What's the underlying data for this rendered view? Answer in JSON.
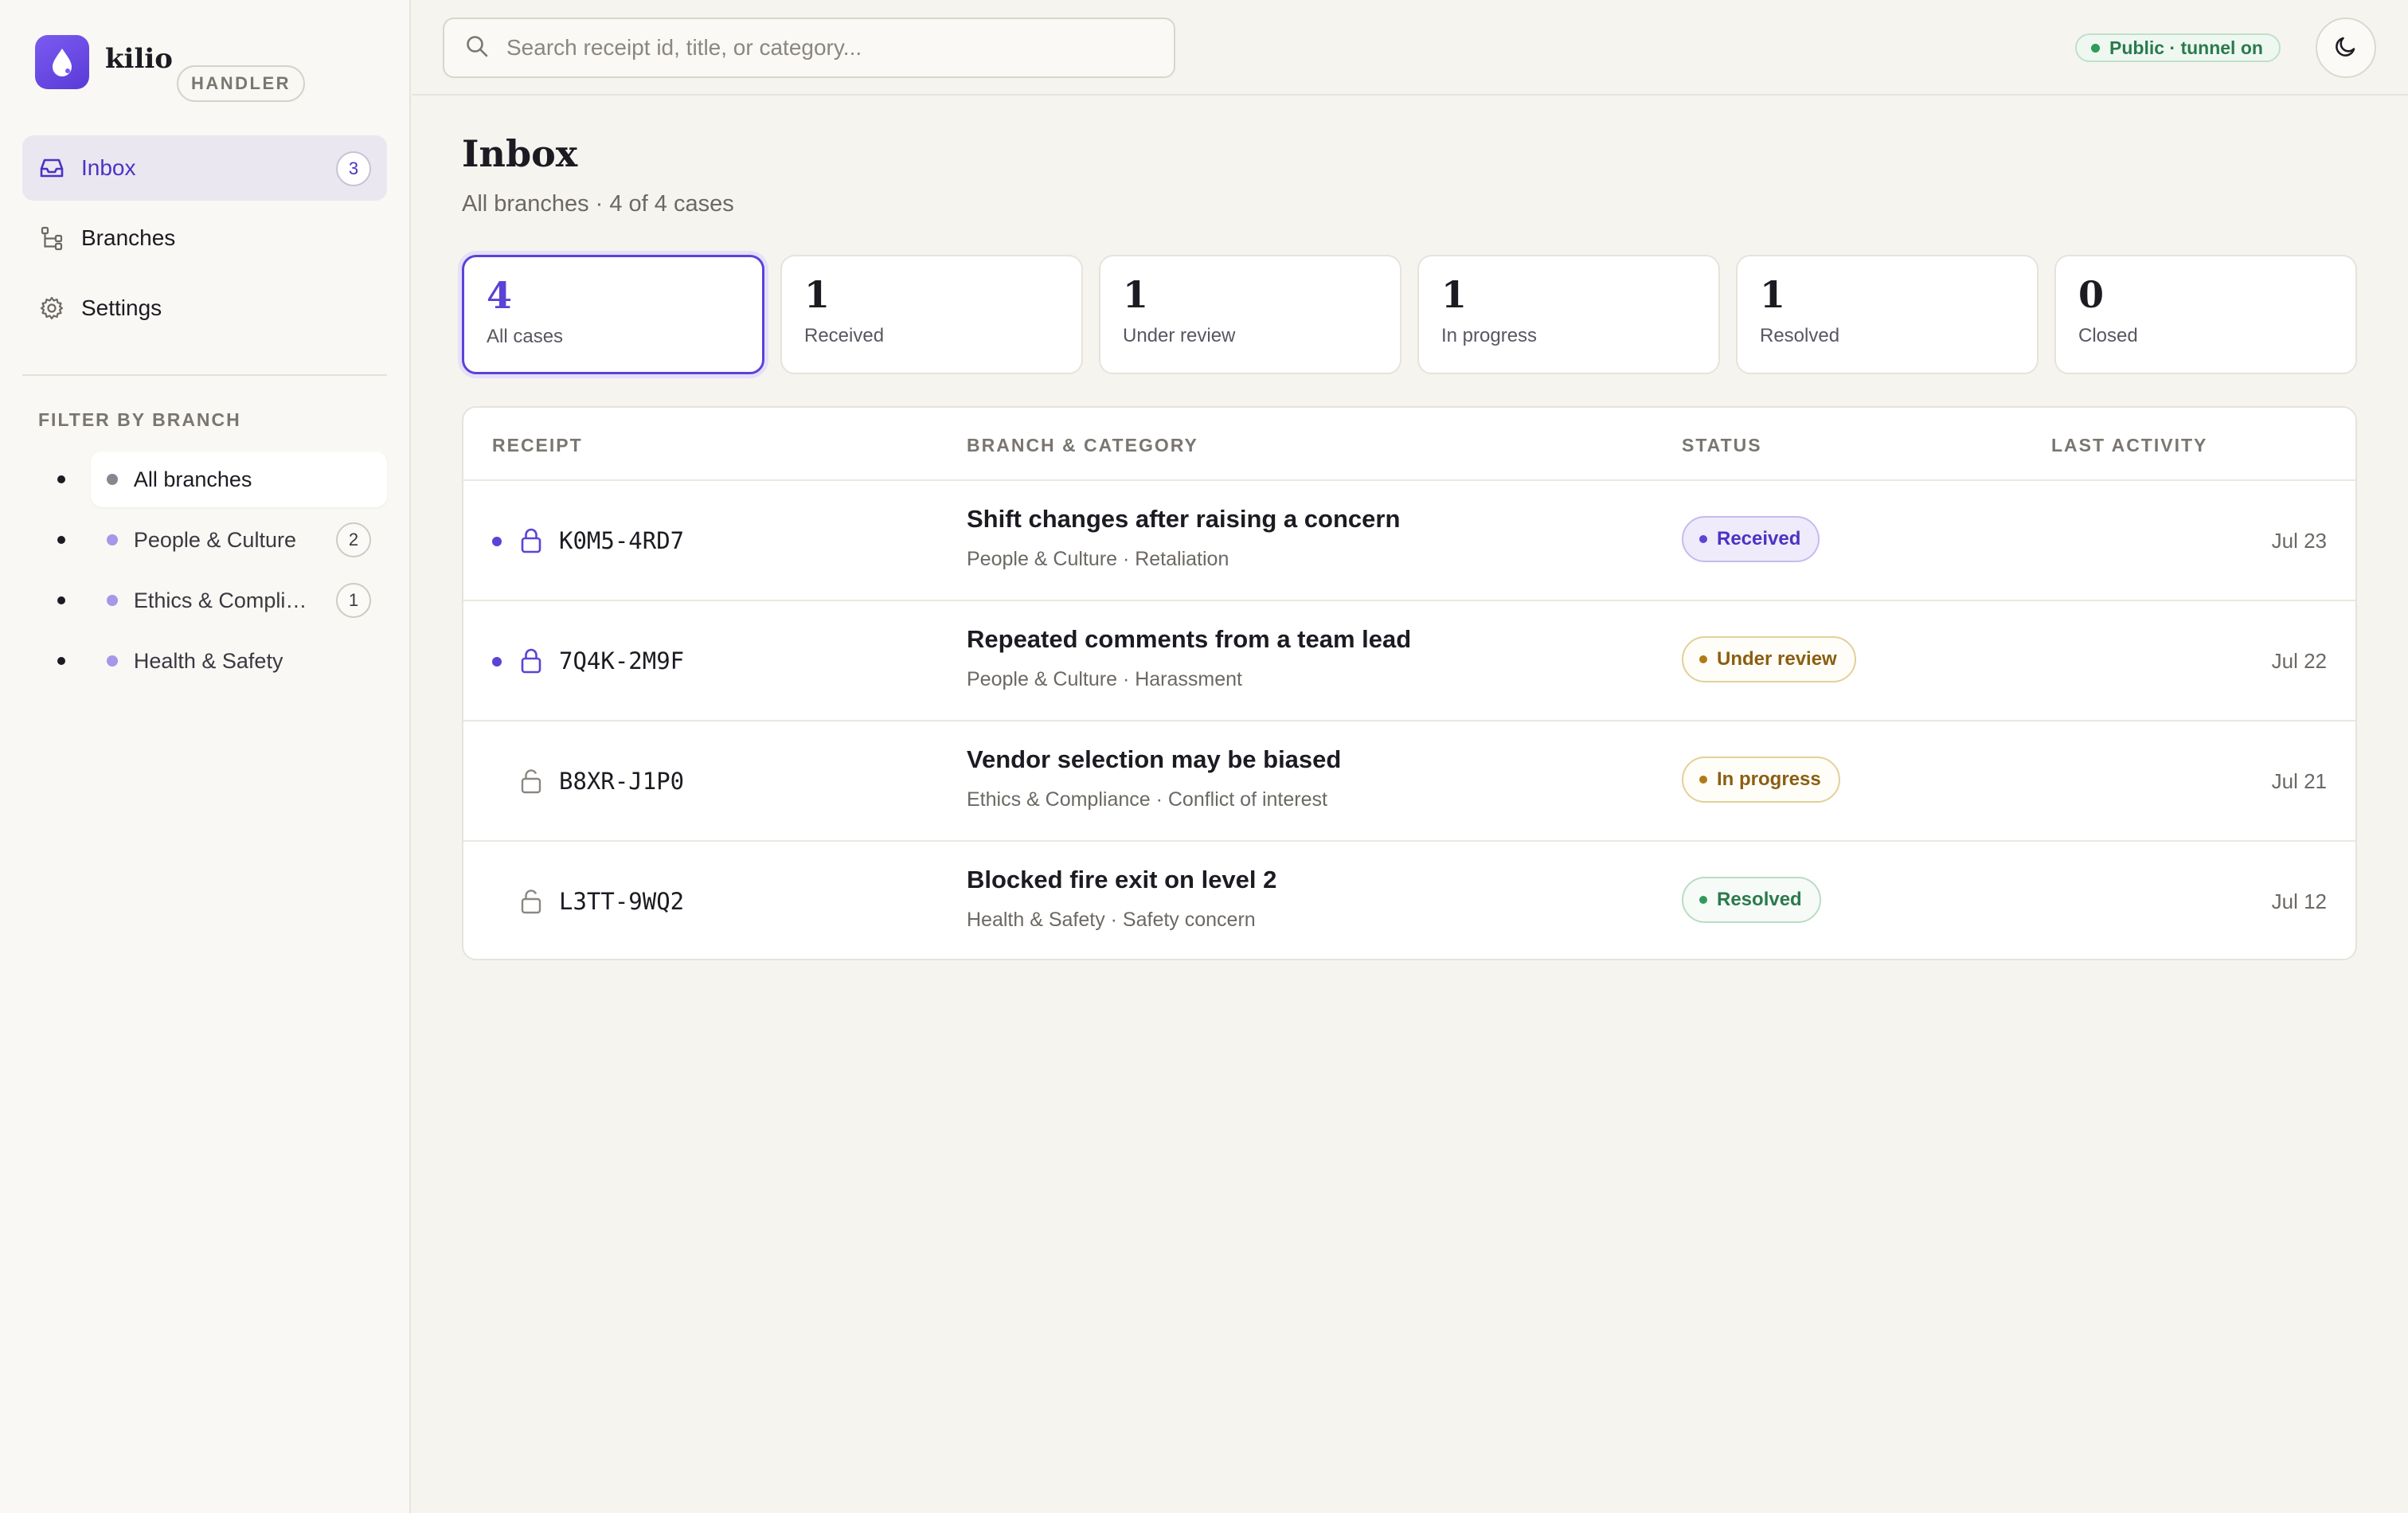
{
  "app": {
    "name": "kilio",
    "role": "HANDLER"
  },
  "nav": {
    "items": [
      {
        "label": "Inbox",
        "count": "3",
        "icon": "inbox-icon",
        "active": true
      },
      {
        "label": "Branches",
        "icon": "branches-icon"
      },
      {
        "label": "Settings",
        "icon": "gear-icon"
      }
    ]
  },
  "filter": {
    "heading": "FILTER BY BRANCH",
    "branches": [
      {
        "label": "All branches",
        "active": true
      },
      {
        "label": "People & Culture",
        "count": "2"
      },
      {
        "label": "Ethics & Compliance",
        "count": "1"
      },
      {
        "label": "Health & Safety"
      }
    ]
  },
  "search": {
    "placeholder": "Search receipt id, title, or category..."
  },
  "tunnel": {
    "label": "Public · tunnel on"
  },
  "page": {
    "title": "Inbox",
    "subtitle": "All branches · 4 of 4 cases"
  },
  "stats": [
    {
      "value": "4",
      "label": "All cases",
      "active": true
    },
    {
      "value": "1",
      "label": "Received"
    },
    {
      "value": "1",
      "label": "Under review"
    },
    {
      "value": "1",
      "label": "In progress"
    },
    {
      "value": "1",
      "label": "Resolved"
    },
    {
      "value": "0",
      "label": "Closed"
    }
  ],
  "table": {
    "headers": {
      "receipt": "RECEIPT",
      "branch_category": "BRANCH & CATEGORY",
      "status": "STATUS",
      "last_activity": "LAST ACTIVITY"
    },
    "rows": [
      {
        "unread": true,
        "locked": true,
        "receipt": "K0M5-4RD7",
        "title": "Shift changes after raising a concern",
        "meta": "People & Culture · Retaliation",
        "status": "Received",
        "date": "Jul 23"
      },
      {
        "unread": true,
        "locked": true,
        "receipt": "7Q4K-2M9F",
        "title": "Repeated comments from a team lead",
        "meta": "People & Culture · Harassment",
        "status": "Under review",
        "date": "Jul 22"
      },
      {
        "unread": false,
        "locked": false,
        "receipt": "B8XR-J1P0",
        "title": "Vendor selection may be biased",
        "meta": "Ethics & Compliance · Conflict of interest",
        "status": "In progress",
        "date": "Jul 21"
      },
      {
        "unread": false,
        "locked": false,
        "receipt": "L3TT-9WQ2",
        "title": "Blocked fire exit on level 2",
        "meta": "Health & Safety · Safety concern",
        "status": "Resolved",
        "date": "Jul 12"
      }
    ]
  },
  "colors": {
    "accent": "#5b43d6",
    "received": "#4b33c4",
    "review": "#8a5f12",
    "resolved": "#2b7a4d"
  }
}
